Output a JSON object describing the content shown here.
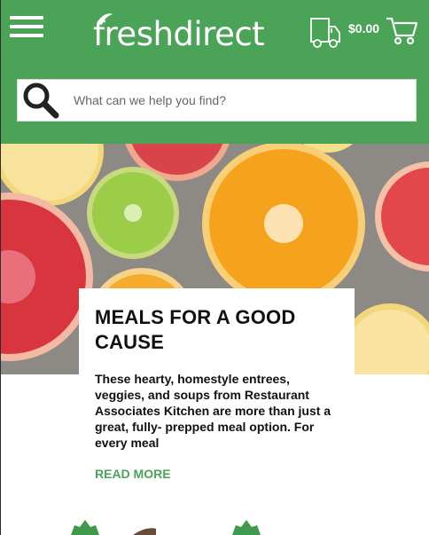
{
  "header": {
    "brand": "freshdirect",
    "cart_total": "$0.00",
    "icons": {
      "menu": "hamburger-menu-icon",
      "delivery": "delivery-truck-icon",
      "cart": "shopping-cart-icon",
      "search": "magnifier-icon"
    }
  },
  "search": {
    "placeholder": "What can we help you find?"
  },
  "hero": {
    "image": "citrus-fruit-slices-photo"
  },
  "feature": {
    "title": "MEALS FOR A GOOD CAUSE",
    "description": "These hearty, homestyle entrees, veggies, and soups from Restaurant Associates Kitchen are more than just a great, fully- prepped meal option. For every meal",
    "cta": "READ MORE"
  },
  "colors": {
    "brand_green": "#4aa357",
    "text_dark": "#111111"
  }
}
